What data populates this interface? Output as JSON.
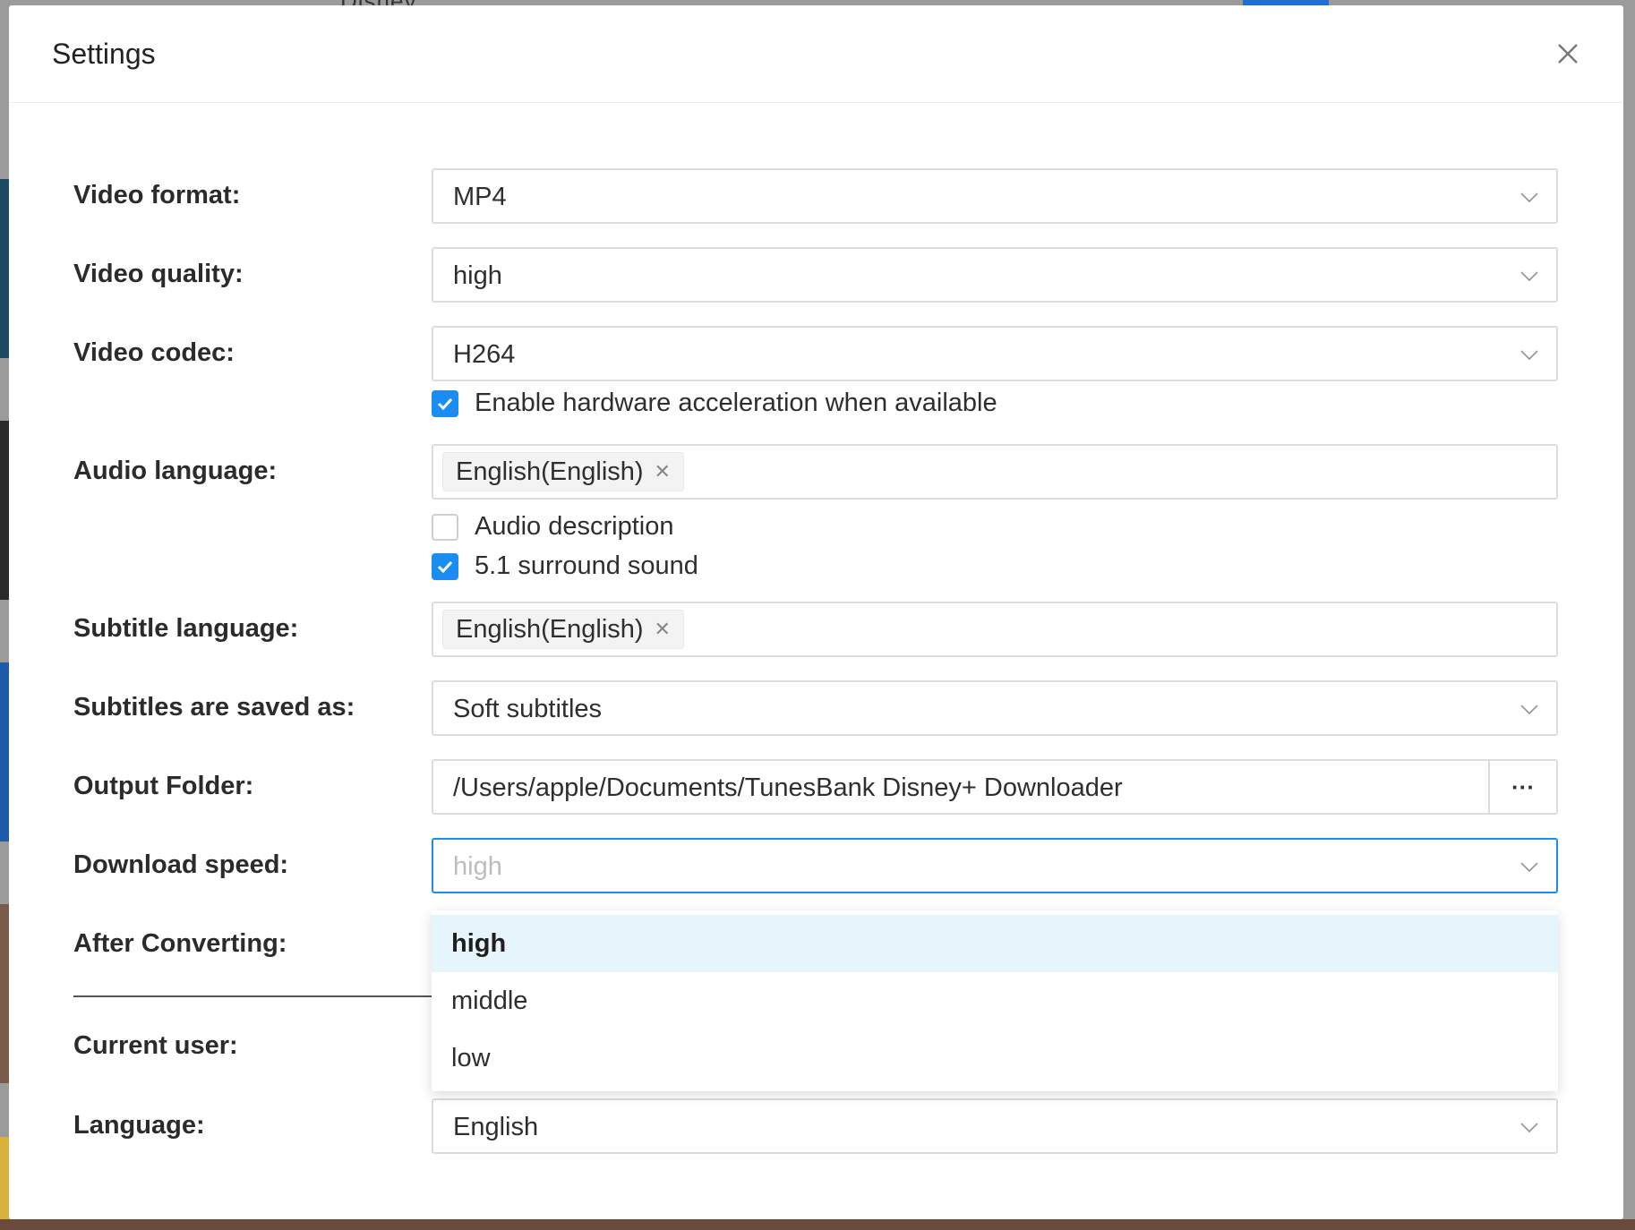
{
  "background": {
    "app_title": "Disney"
  },
  "dialog": {
    "title": "Settings",
    "close_icon": "close-icon"
  },
  "settings": {
    "video_format": {
      "label": "Video format:",
      "value": "MP4"
    },
    "video_quality": {
      "label": "Video quality:",
      "value": "high"
    },
    "video_codec": {
      "label": "Video codec:",
      "value": "H264"
    },
    "hardware_acceleration": {
      "label": "Enable hardware acceleration when available",
      "checked": true
    },
    "audio_language": {
      "label": "Audio language:",
      "tags": [
        "English(English)"
      ]
    },
    "audio_description": {
      "label": "Audio description",
      "checked": false
    },
    "surround_sound": {
      "label": "5.1 surround sound",
      "checked": true
    },
    "subtitle_language": {
      "label": "Subtitle language:",
      "tags": [
        "English(English)"
      ]
    },
    "subtitles_saved_as": {
      "label": "Subtitles are saved as:",
      "value": "Soft subtitles"
    },
    "output_folder": {
      "label": "Output Folder:",
      "value": "/Users/apple/Documents/TunesBank Disney+ Downloader",
      "browse_label": "···"
    },
    "download_speed": {
      "label": "Download speed:",
      "placeholder": "high",
      "options": [
        "high",
        "middle",
        "low"
      ],
      "highlighted": "high"
    },
    "after_converting": {
      "label": "After Converting:"
    },
    "current_user": {
      "label": "Current user:"
    },
    "language": {
      "label": "Language:",
      "value": "English"
    }
  },
  "colors": {
    "accent": "#1b8cf2",
    "highlight_bg": "#e6f5fc"
  }
}
